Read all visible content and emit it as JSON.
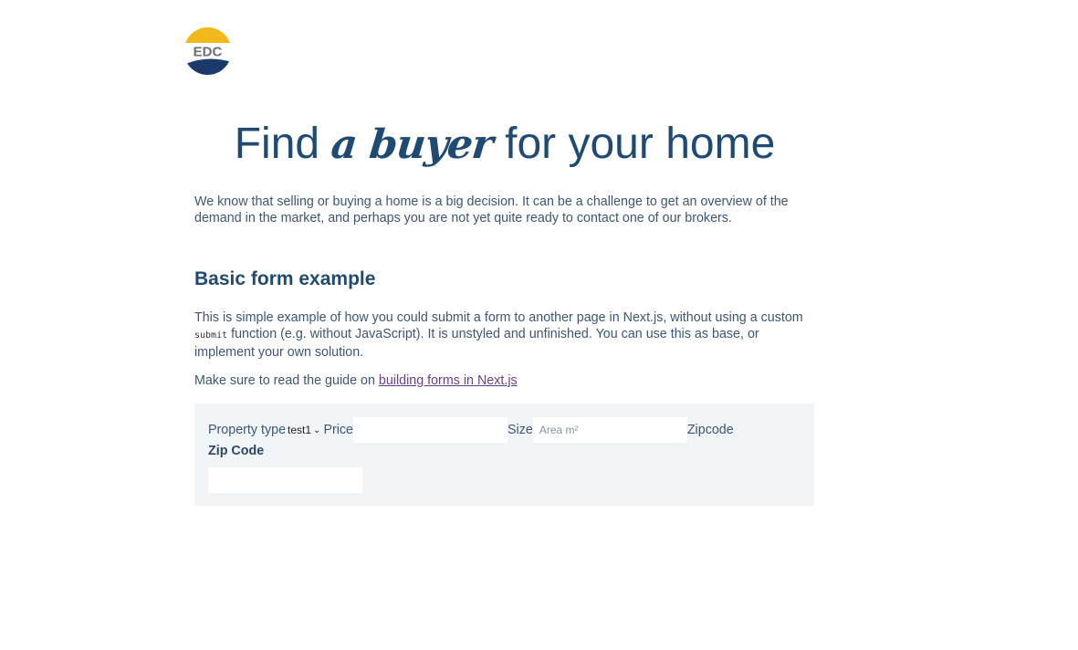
{
  "header": {
    "logo_text": "EDC",
    "title_prefix": "Find",
    "title_accent": "a buyer",
    "title_suffix": "for your home"
  },
  "intro": "We know that selling or buying a home is a big decision. It can be a challenge to get an overview of the demand in the market, and perhaps you are not yet quite ready to contact one of our brokers.",
  "section": {
    "title": "Basic form example",
    "para1_before": "This is simple example of how you could submit a form to another page in Next.js, without using a custom ",
    "para1_code": "submit",
    "para1_after": " function (e.g. without JavaScript). It is unstyled and unfinished. You can use this as base, or implement your own solution.",
    "para2_before": "Make sure to read the guide on ",
    "para2_link": "building forms in Next.js"
  },
  "form": {
    "property_type_label": "Property type",
    "property_type_value": "test1",
    "price_label": "Price",
    "price_value": "",
    "size_label": "Size",
    "size_placeholder": "Area m²",
    "zipcode_label": "Zipcode",
    "zip_code_label": "Zip Code",
    "zip_code_value": ""
  },
  "colors": {
    "brand_blue": "#1f4a73",
    "logo_yellow": "#f2b81c",
    "logo_navy": "#1b3a6b",
    "link_purple": "#6b3d8e",
    "form_bg": "#f2f5f7"
  }
}
